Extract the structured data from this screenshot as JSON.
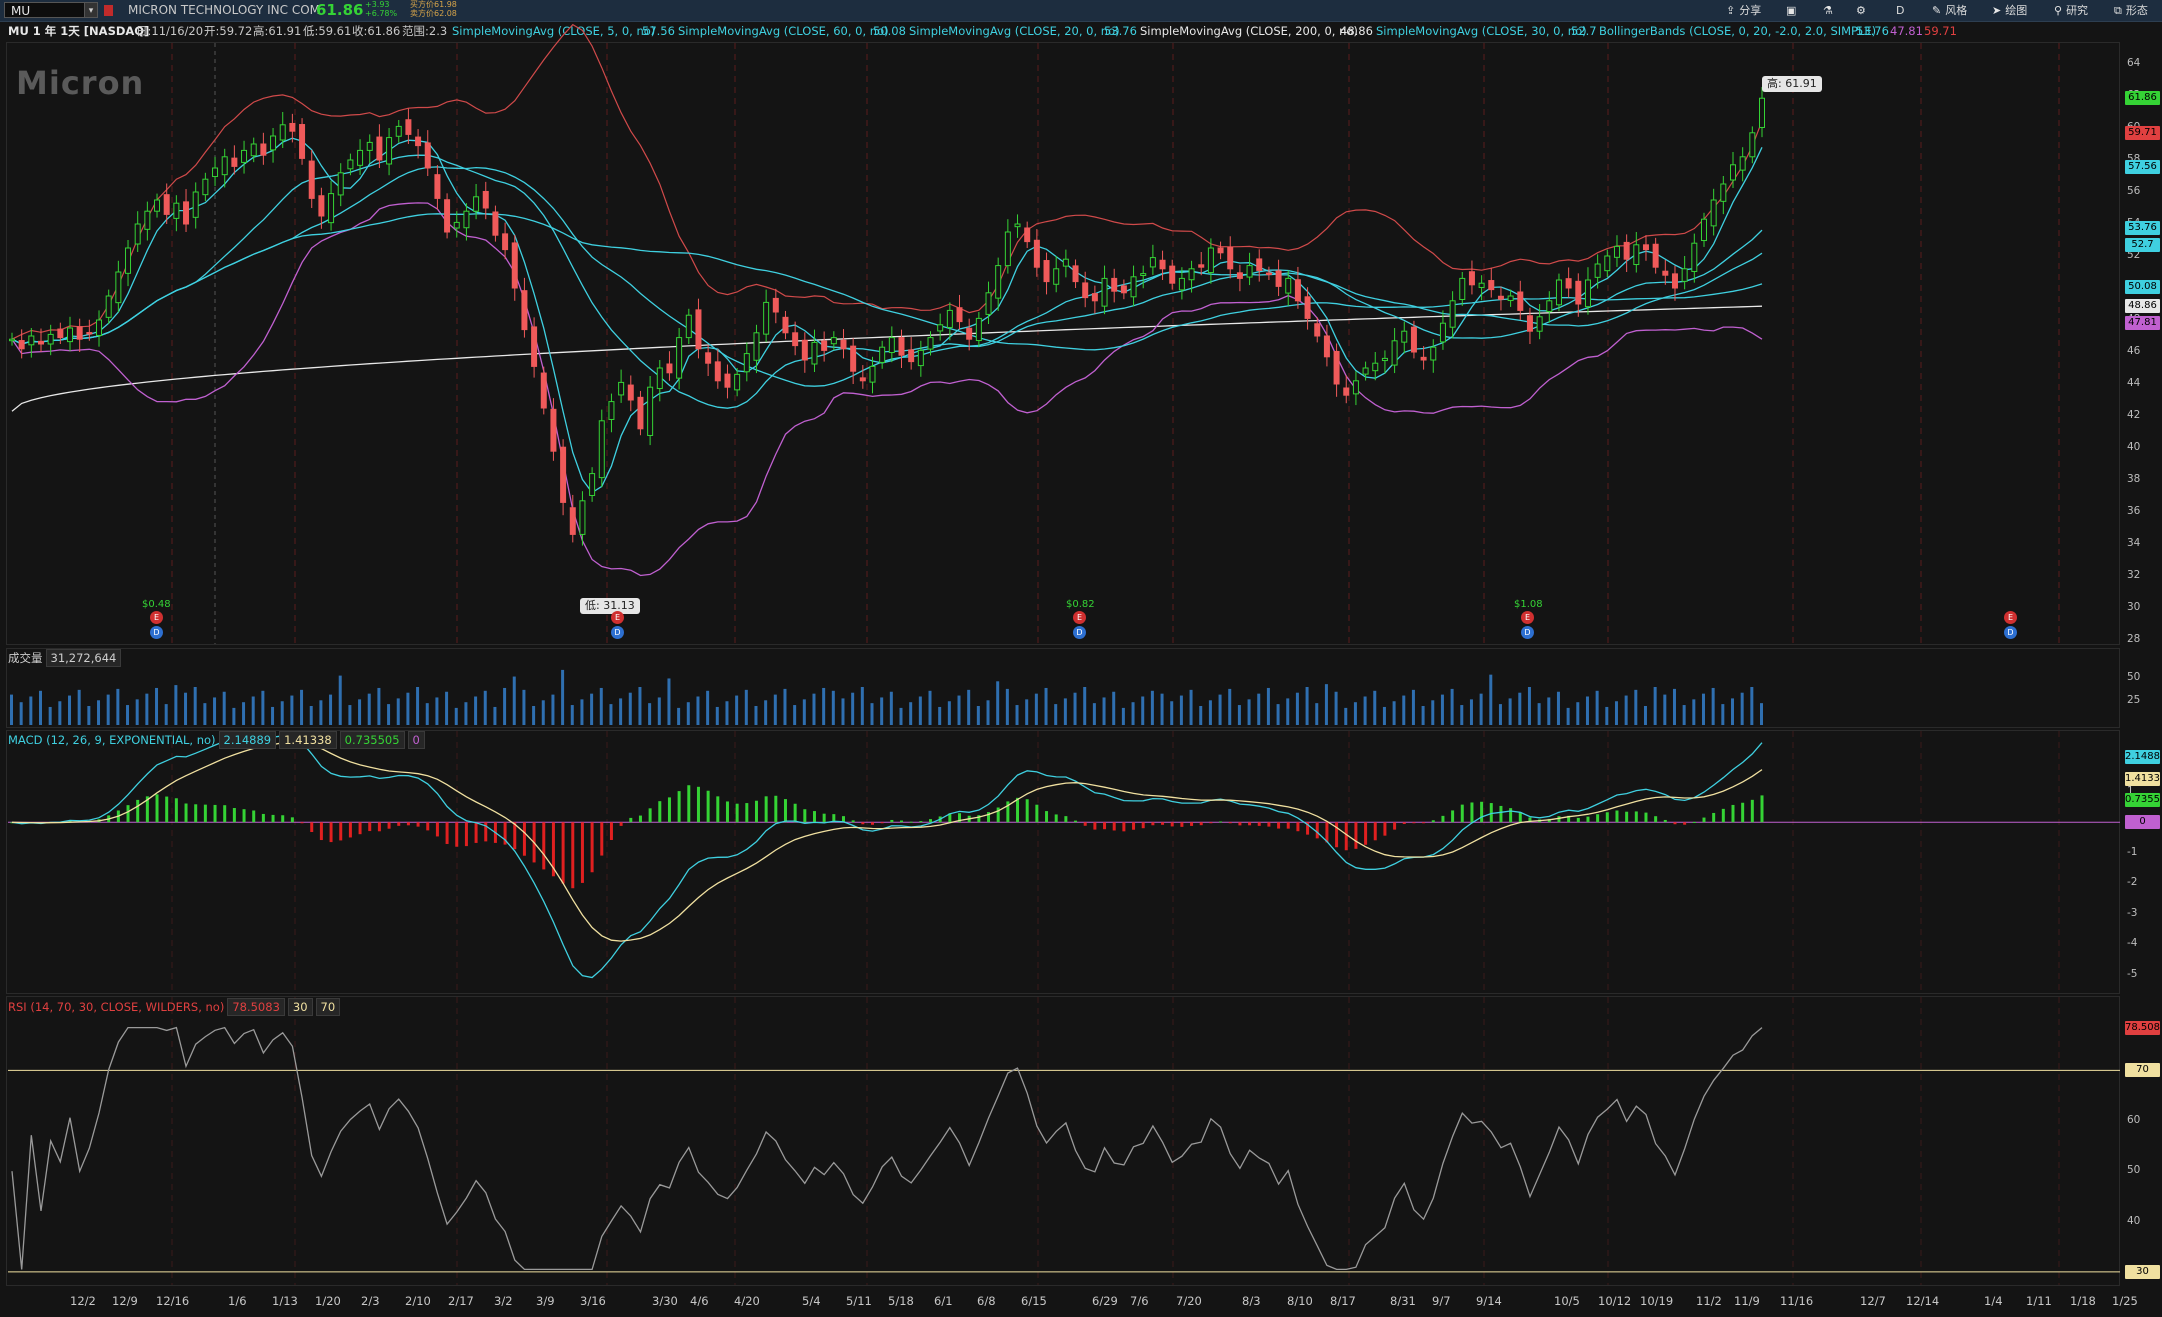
{
  "toolbar": {
    "symbol": "MU",
    "company": "MICRON TECHNOLOGY INC COM",
    "last_price": "61.86",
    "change": "+3.93",
    "change_pct": "+6.78%",
    "bid": "买方价61.98",
    "ask": "卖方价62.08",
    "buttons": [
      {
        "label": "分享",
        "icon": "share-icon"
      },
      {
        "label": "",
        "icon": "save-icon"
      },
      {
        "label": "",
        "icon": "flask-icon"
      },
      {
        "label": "",
        "icon": "gear-icon"
      },
      {
        "label": "D",
        "icon": ""
      },
      {
        "label": "风格",
        "icon": "style-icon"
      },
      {
        "label": "绘图",
        "icon": "cursor-icon"
      },
      {
        "label": "研究",
        "icon": "study-icon"
      },
      {
        "label": "形态",
        "icon": "pattern-icon"
      }
    ]
  },
  "infobar": {
    "title": "MU 1 年 1天 [NASDAQ]",
    "date": "日:11/16/20",
    "open": "开:59.72",
    "high": "高:61.91",
    "low": "低:59.61",
    "close": "收:61.86",
    "range": "范围:2.3",
    "indicators": [
      {
        "label": "SimpleMovingAvg (CLOSE, 5, 0, no)",
        "value": "57.56",
        "color": "#3fd0e0"
      },
      {
        "label": "SimpleMovingAvg (CLOSE, 60, 0, no)",
        "value": "50.08",
        "color": "#3fd0e0"
      },
      {
        "label": "SimpleMovingAvg (CLOSE, 20, 0, no)",
        "value": "53.76",
        "color": "#3fd0e0"
      },
      {
        "label": "SimpleMovingAvg (CLOSE, 200, 0, no)",
        "value": "48.86",
        "color": "#e8e8e8"
      },
      {
        "label": "SimpleMovingAvg (CLOSE, 30, 0, no)",
        "value": "52.7",
        "color": "#3fd0e0"
      },
      {
        "label": "BollingerBands (CLOSE, 0, 20, -2.0, 2.0, SIMPLE)",
        "value": "53.76",
        "color": "#3fd0e0"
      }
    ],
    "bb_lower": "47.81",
    "bb_upper": "59.71"
  },
  "price_pane": {
    "watermark": "Micron",
    "high_bubble": "高: 61.91",
    "low_bubble": "低: 31.13",
    "y_ticks": [
      "64",
      "62",
      "60",
      "58",
      "56",
      "54",
      "52",
      "50",
      "48",
      "46",
      "44",
      "42",
      "40",
      "38",
      "36",
      "34",
      "32",
      "30",
      "28"
    ],
    "tags": [
      {
        "value": "61.86",
        "color": "#35d335"
      },
      {
        "value": "59.71",
        "color": "#e04040"
      },
      {
        "value": "57.56",
        "color": "#3fd0e0"
      },
      {
        "value": "53.76",
        "color": "#3fd0e0"
      },
      {
        "value": "52.7",
        "color": "#3fd0e0"
      },
      {
        "value": "50.08",
        "color": "#3fd0e0"
      },
      {
        "value": "48.86",
        "color": "#e8e8e8"
      },
      {
        "value": "47.81",
        "color": "#c060d0"
      }
    ],
    "earnings": [
      "$0.48",
      "$0.82",
      "$1.08"
    ]
  },
  "volume_pane": {
    "label": "成交量",
    "value": "31,272,644",
    "y_ticks": [
      "50",
      "25"
    ]
  },
  "macd_pane": {
    "label": "MACD (12, 26, 9, EXPONENTIAL, no)",
    "value": "2.14889",
    "avg": "1.41338",
    "diff": "0.735505",
    "zero": "0",
    "y_ticks": [
      "2",
      "1",
      "0",
      "-1",
      "-2",
      "-3",
      "-4",
      "-5"
    ],
    "tags": [
      {
        "value": "2.1488",
        "color": "#3fd0e0"
      },
      {
        "value": "1.4133",
        "color": "#f0e0a0"
      },
      {
        "value": "0.7355",
        "color": "#35d335"
      },
      {
        "value": "0",
        "color": "#c060d0"
      }
    ]
  },
  "rsi_pane": {
    "label": "RSI (14, 70, 30, CLOSE, WILDERS, no)",
    "value": "78.5083",
    "ob": "30",
    "os": "70",
    "y_ticks": [
      "60",
      "50",
      "40"
    ],
    "tags": [
      {
        "value": "78.508",
        "color": "#e04040"
      },
      {
        "value": "70",
        "color": "#f0e0a0"
      },
      {
        "value": "30",
        "color": "#f0e0a0"
      }
    ]
  },
  "x_axis": [
    "12/2",
    "12/9",
    "12/16",
    "1/6",
    "1/13",
    "1/20",
    "2/3",
    "2/10",
    "2/17",
    "3/2",
    "3/9",
    "3/16",
    "3/30",
    "4/6",
    "4/20",
    "5/4",
    "5/11",
    "5/18",
    "6/1",
    "6/8",
    "6/15",
    "6/29",
    "7/6",
    "7/20",
    "8/3",
    "8/10",
    "8/17",
    "8/31",
    "9/7",
    "9/14",
    "10/5",
    "10/12",
    "10/19",
    "11/2",
    "11/9",
    "11/16",
    "12/7",
    "12/14",
    "1/4",
    "1/11",
    "1/18",
    "1/25"
  ],
  "series": {
    "close": [
      46.8,
      46.2,
      47.0,
      46.5,
      47.1,
      46.9,
      47.5,
      46.8,
      47.2,
      48.0,
      49.5,
      51.0,
      52.5,
      54.0,
      54.8,
      55.5,
      54.6,
      55.3,
      54.0,
      56.0,
      56.8,
      57.5,
      58.2,
      57.6,
      58.6,
      59.0,
      58.3,
      59.5,
      60.2,
      59.8,
      58.1,
      55.6,
      54.5,
      55.9,
      57.2,
      58.0,
      58.6,
      59.1,
      58.0,
      59.4,
      60.1,
      59.6,
      58.9,
      57.5,
      55.6,
      53.5,
      54.1,
      54.8,
      55.7,
      55.0,
      53.3,
      52.4,
      50.0,
      47.4,
      45.1,
      42.5,
      39.8,
      36.6,
      34.6,
      36.7,
      38.4,
      41.7,
      42.9,
      44.1,
      43.0,
      41.2,
      43.8,
      45.0,
      44.7,
      46.9,
      48.3,
      46.2,
      45.3,
      44.2,
      43.8,
      44.6,
      45.9,
      47.2,
      49.1,
      48.5,
      47.2,
      46.4,
      45.5,
      46.6,
      46.1,
      46.9,
      46.2,
      44.8,
      44.2,
      45.1,
      46.3,
      46.9,
      45.8,
      45.4,
      46.1,
      46.9,
      47.7,
      48.6,
      47.9,
      46.8,
      48.1,
      49.7,
      51.4,
      53.5,
      54.0,
      52.9,
      51.3,
      50.4,
      51.2,
      51.8,
      50.4,
      49.4,
      49.2,
      50.6,
      49.8,
      49.7,
      50.7,
      50.9,
      51.9,
      51.2,
      50.3,
      50.6,
      51.2,
      51.3,
      52.5,
      52.2,
      51.2,
      50.6,
      51.4,
      51.1,
      50.9,
      50.1,
      50.6,
      49.2,
      48.1,
      47.0,
      45.7,
      44.0,
      43.3,
      44.2,
      45.0,
      45.3,
      45.6,
      46.7,
      47.3,
      46.0,
      45.5,
      46.3,
      47.8,
      49.2,
      50.6,
      50.2,
      50.3,
      49.9,
      49.3,
      49.5,
      48.6,
      47.3,
      48.2,
      49.2,
      50.5,
      50.0,
      49.0,
      50.5,
      51.5,
      52.0,
      52.6,
      51.8,
      52.7,
      52.4,
      51.3,
      50.8,
      50.0,
      51.2,
      52.8,
      54.3,
      55.5,
      56.5,
      57.7,
      58.2,
      59.7,
      61.86
    ],
    "sma200_start": 42.3,
    "sma200_end": 48.86
  }
}
